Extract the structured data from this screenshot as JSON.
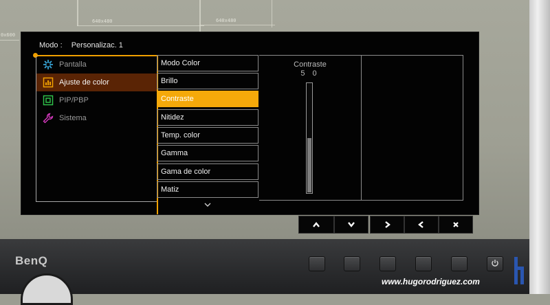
{
  "osd": {
    "mode_label": "Modo :",
    "mode_value": "Personalizac. 1",
    "categories": [
      {
        "label": "Pantalla",
        "icon": "display-arrows-icon",
        "color": "#3bb0e6"
      },
      {
        "label": "Ajuste de color",
        "icon": "color-chart-icon",
        "color": "#f0a000"
      },
      {
        "label": "PIP/PBP",
        "icon": "pip-icon",
        "color": "#2fc04a"
      },
      {
        "label": "Sistema",
        "icon": "wrench-icon",
        "color": "#e03cc8"
      }
    ],
    "active_category": 1,
    "submenu": [
      "Modo Color",
      "Brillo",
      "Contraste",
      "Nitidez",
      "Temp. color",
      "Gamma",
      "Gama de color",
      "Matiz"
    ],
    "active_submenu": 2,
    "value_title": "Contraste",
    "value_display": "5 0",
    "value_level": 50,
    "nav_keys": [
      {
        "name": "up-key",
        "icon": "chevron-up-icon"
      },
      {
        "name": "down-key",
        "icon": "chevron-down-icon"
      },
      {
        "name": "right-key",
        "icon": "chevron-right-icon"
      },
      {
        "name": "left-key",
        "icon": "chevron-left-icon"
      },
      {
        "name": "exit-key",
        "icon": "close-icon"
      }
    ],
    "accent": "#f5a90a"
  },
  "background": {
    "resolution_labels": [
      "640x480",
      "640x480",
      "0x600"
    ]
  },
  "monitor": {
    "brand": "BenQ",
    "watermark": "www.hugorodriguez.com"
  }
}
